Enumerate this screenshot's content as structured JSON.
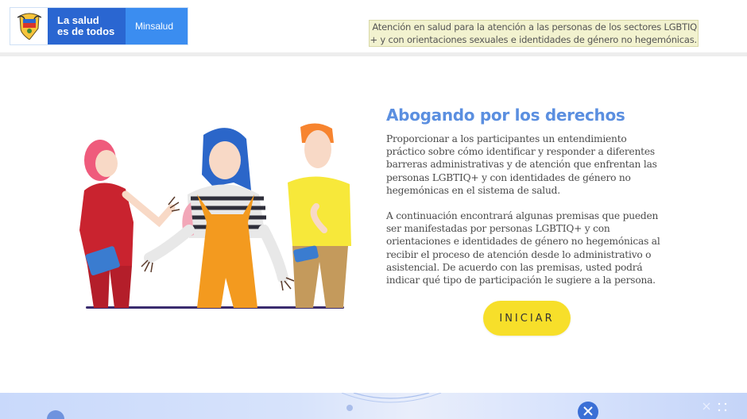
{
  "header": {
    "logo": {
      "line1": "La salud",
      "line2": "es de todos",
      "ministry": "Minsalud"
    },
    "notice": {
      "line1": "Atención en salud para la atención a las personas de los sectores LGBTIQ",
      "line2": "+ y con orientaciones sexuales e identidades de género no hegemónicas."
    }
  },
  "main": {
    "title": "Abogando por los derechos",
    "paragraph1": "Proporcionar a los participantes un entendimiento práctico sobre cómo identificar y responder a diferentes barreras administrativas y de atención que enfrentan las personas LGBTIQ+ y con identidades de género no hegemónicas en el sistema de salud.",
    "paragraph2": "A continuación encontrará algunas premisas que pueden ser manifestadas por personas LGBTIQ+ y con orientaciones e identidades de género no hegemónicas al recibir el proceso de atención desde lo administrativo o asistencial. De acuerdo con las premisas, usted podrá indicar qué tipo de participación le sugiere a la persona.",
    "start_label": "INICIAR"
  },
  "colors": {
    "brand_blue": "#2a66d1",
    "ministry_blue": "#3b8df0",
    "title_blue": "#5b8fe0",
    "button_yellow": "#f7df2a"
  },
  "icons": {
    "seal": "colombia-coat-of-arms-icon",
    "illustration": "three-people-conversation-illustration"
  }
}
